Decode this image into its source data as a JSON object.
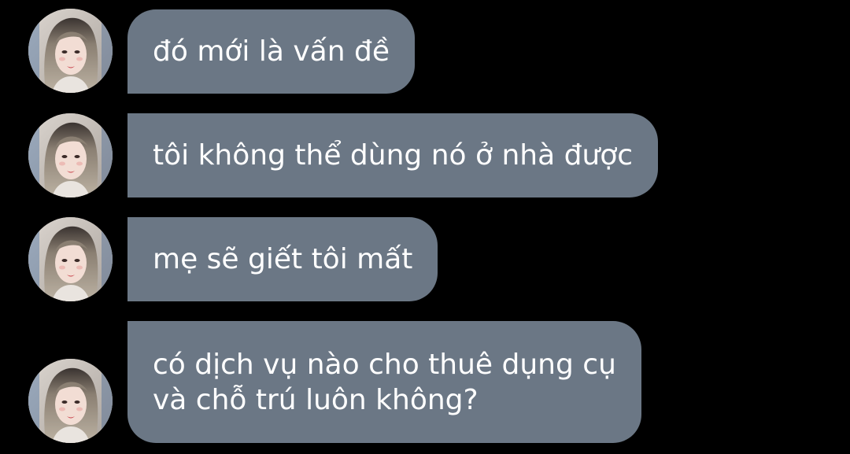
{
  "colors": {
    "background": "#000000",
    "bubble": "#6b7785",
    "text": "#ffffff"
  },
  "messages": [
    {
      "avatar_icon": "profile-photo-avatar",
      "lines": [
        "đó mới là vấn đề"
      ]
    },
    {
      "avatar_icon": "profile-photo-avatar",
      "lines": [
        "tôi không thể dùng nó ở nhà được"
      ]
    },
    {
      "avatar_icon": "profile-photo-avatar",
      "lines": [
        "mẹ sẽ giết tôi mất"
      ]
    },
    {
      "avatar_icon": "profile-photo-avatar",
      "lines": [
        "có dịch vụ nào cho thuê dụng cụ",
        "và chỗ trú luôn không?"
      ]
    }
  ]
}
